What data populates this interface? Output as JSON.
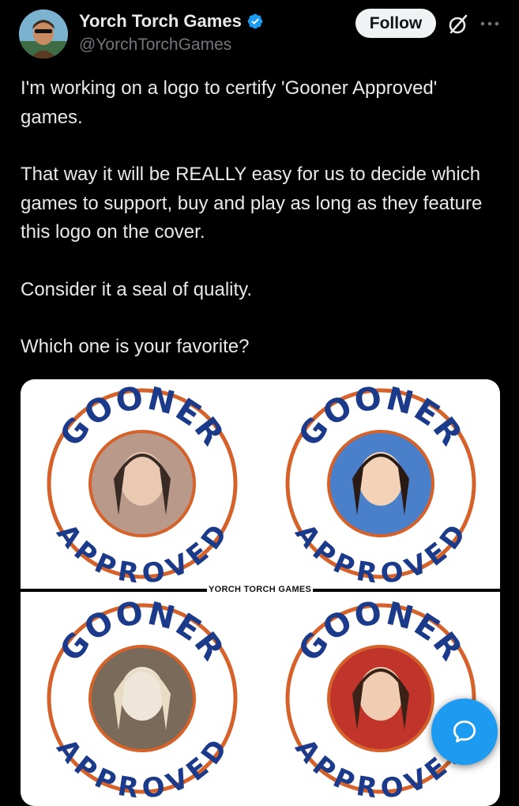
{
  "author": {
    "display_name": "Yorch Torch Games",
    "handle": "@YorchTorchGames",
    "verified": true,
    "avatar_icon": "avatar-portrait"
  },
  "actions": {
    "follow_label": "Follow",
    "grok_icon": "grok-icon",
    "more_icon": "more-dots-icon"
  },
  "tweet": {
    "paragraphs": [
      "I'm working on a logo to certify 'Gooner Approved' games.",
      "That way it will be REALLY easy for us to decide which games to support, buy and play as long as they feature this logo on the cover.",
      "Consider it a seal of quality.",
      "Which one is your favorite?"
    ]
  },
  "media": {
    "logo_top_text": "GOONER",
    "logo_bottom_text": "APPROVED",
    "watermark": "YORCH TORCH GAMES",
    "ring_color": "#d4622a",
    "text_color": "#1b3a8a"
  },
  "fab": {
    "icon": "compose-reply-icon",
    "color": "#1d9bf0"
  }
}
